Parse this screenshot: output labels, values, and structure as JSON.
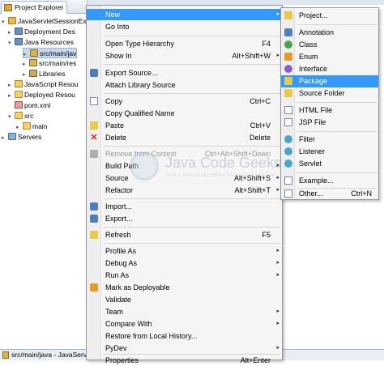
{
  "explorer": {
    "tab_title": "Project Explorer",
    "tree": [
      {
        "label": "JavaServletSessionEx",
        "icon": "project-icon",
        "twisty": "▾"
      },
      {
        "label": "Deployment Des",
        "icon": "descriptor-icon",
        "twisty": "▸"
      },
      {
        "label": "Java Resources",
        "icon": "java-resources-icon",
        "twisty": "▾"
      },
      {
        "label": "src/main/jav",
        "icon": "package-folder-icon",
        "twisty": "▸"
      },
      {
        "label": "src/main/res",
        "icon": "package-folder-icon",
        "twisty": "▸"
      },
      {
        "label": "Libraries",
        "icon": "library-icon",
        "twisty": "▸"
      },
      {
        "label": "JavaScript Resou",
        "icon": "javascript-icon",
        "twisty": "▸"
      },
      {
        "label": "Deployed Resou",
        "icon": "folder-icon",
        "twisty": "▸"
      },
      {
        "label": "pom.xml",
        "icon": "xml-file-icon",
        "twisty": ""
      },
      {
        "label": "src",
        "icon": "folder-icon",
        "twisty": "▾"
      },
      {
        "label": "main",
        "icon": "folder-icon",
        "twisty": "▸"
      },
      {
        "label": "Servers",
        "icon": "servers-icon",
        "twisty": "▸"
      }
    ]
  },
  "status_bar": {
    "text": "src/main/java - JavaServle"
  },
  "context_menu": {
    "items": [
      {
        "label": "New",
        "shortcut": "",
        "arrow": "▸",
        "highlight": true
      },
      {
        "label": "Go Into",
        "shortcut": ""
      },
      {
        "label": "Open Type Hierarchy",
        "shortcut": "F4"
      },
      {
        "label": "Show In",
        "shortcut": "Alt+Shift+W",
        "arrow": "▸"
      },
      {
        "label": "Export Source...",
        "shortcut": ""
      },
      {
        "label": "Attach Library Source",
        "shortcut": ""
      },
      {
        "label": "Copy",
        "shortcut": "Ctrl+C"
      },
      {
        "label": "Copy Qualified Name",
        "shortcut": ""
      },
      {
        "label": "Paste",
        "shortcut": "Ctrl+V"
      },
      {
        "label": "Delete",
        "shortcut": "Delete"
      },
      {
        "label": "Remove from Context",
        "shortcut": "Ctrl+Alt+Shift+Down",
        "disabled": true
      },
      {
        "label": "Build Path",
        "shortcut": "",
        "arrow": "▸"
      },
      {
        "label": "Source",
        "shortcut": "Alt+Shift+S",
        "arrow": "▸"
      },
      {
        "label": "Refactor",
        "shortcut": "Alt+Shift+T",
        "arrow": "▸"
      },
      {
        "label": "Import...",
        "shortcut": ""
      },
      {
        "label": "Export...",
        "shortcut": ""
      },
      {
        "label": "Refresh",
        "shortcut": "F5"
      },
      {
        "label": "Profile As",
        "shortcut": "",
        "arrow": "▸"
      },
      {
        "label": "Debug As",
        "shortcut": "",
        "arrow": "▸"
      },
      {
        "label": "Run As",
        "shortcut": "",
        "arrow": "▸"
      },
      {
        "label": "Mark as Deployable",
        "shortcut": ""
      },
      {
        "label": "Validate",
        "shortcut": ""
      },
      {
        "label": "Team",
        "shortcut": "",
        "arrow": "▸"
      },
      {
        "label": "Compare With",
        "shortcut": "",
        "arrow": "▸"
      },
      {
        "label": "Restore from Local History...",
        "shortcut": ""
      },
      {
        "label": "PyDev",
        "shortcut": "",
        "arrow": "▸"
      },
      {
        "label": "Properties",
        "shortcut": "Alt+Enter"
      }
    ]
  },
  "new_submenu": {
    "items": [
      {
        "label": "Project...",
        "shortcut": ""
      },
      {
        "label": "Annotation",
        "shortcut": ""
      },
      {
        "label": "Class",
        "shortcut": ""
      },
      {
        "label": "Enum",
        "shortcut": ""
      },
      {
        "label": "Interface",
        "shortcut": ""
      },
      {
        "label": "Package",
        "shortcut": "",
        "highlight": true
      },
      {
        "label": "Source Folder",
        "shortcut": ""
      },
      {
        "label": "HTML File",
        "shortcut": ""
      },
      {
        "label": "JSP File",
        "shortcut": ""
      },
      {
        "label": "Filter",
        "shortcut": ""
      },
      {
        "label": "Listener",
        "shortcut": ""
      },
      {
        "label": "Servlet",
        "shortcut": ""
      },
      {
        "label": "Example...",
        "shortcut": ""
      },
      {
        "label": "Other...",
        "shortcut": "Ctrl+N"
      }
    ]
  },
  "watermark": {
    "brand": "Java Code Geeks",
    "tagline": "JAVA 2 JAVA DEVELOPERS RESOURCE CENTER"
  }
}
